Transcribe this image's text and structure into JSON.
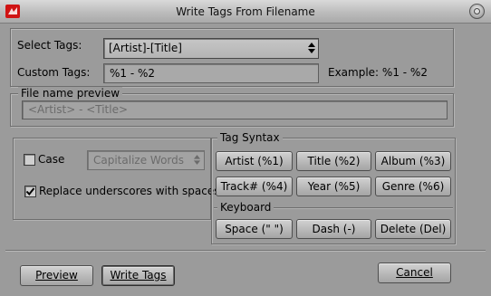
{
  "window": {
    "title": "Write Tags From Filename"
  },
  "tags": {
    "select_label": "Select Tags:",
    "select_value": "[Artist]-[Title]",
    "custom_label": "Custom Tags:",
    "custom_value": "%1 - %2",
    "example_text": "Example: %1 - %2"
  },
  "preview": {
    "legend": "File name preview",
    "value": "<Artist> - <Title>"
  },
  "options": {
    "case_label": "Case",
    "case_checked": false,
    "case_select_value": "Capitalize Words",
    "replace_label": "Replace underscores with spaces",
    "replace_checked": true
  },
  "tag_syntax": {
    "legend": "Tag Syntax",
    "buttons": [
      "Artist (%1)",
      "Title (%2)",
      "Album (%3)",
      "Track# (%4)",
      "Year (%5)",
      "Genre (%6)"
    ]
  },
  "keyboard": {
    "legend": "Keyboard",
    "buttons": [
      "Space (\" \")",
      "Dash (-)",
      "Delete (Del)"
    ]
  },
  "footer": {
    "preview_label": "Preview",
    "write_label": "Write Tags",
    "cancel_label": "Cancel"
  },
  "colors": {
    "background": "#9b9b9b",
    "field": "#a9a9a9",
    "app_icon": "#d01414"
  },
  "icons": {
    "app": "app-icon",
    "close": "window-close-icon",
    "dropdown": "spinner-arrows-icon",
    "check": "checkmark-icon"
  }
}
